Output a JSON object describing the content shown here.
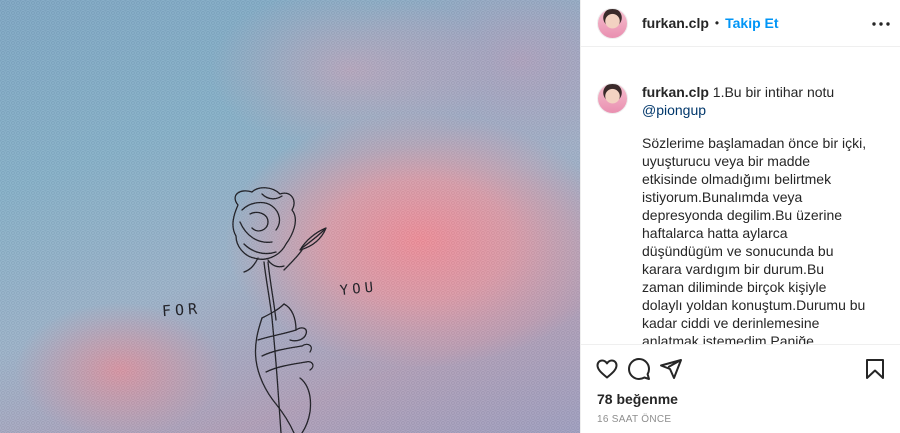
{
  "post": {
    "photo": {
      "label_left": "FOR",
      "label_right": "YOU"
    },
    "header": {
      "username": "furkan.clp",
      "separator": "•",
      "follow_label": "Takip Et",
      "more_icon": "more-horizontal-icon"
    },
    "caption": {
      "username": "furkan.clp",
      "title": "1.Bu bir intihar notu",
      "mention": "@piongup",
      "body": "Sözlerime başlamadan önce bir içki, uyuşturucu veya bir madde etkisinde olmadığımı belirtmek istiyorum.Bunalımda veya depresyonda degilim.Bu üzerine haftalarca hatta aylarca düşündügüm ve sonucunda bu karara vardıgım bir durum.Bu zaman diliminde birçok kişiyle dolaylı yoldan konuştum.Durumu bu kadar ciddi ve derinlemesine anlatmak istemedim.Paniğe kapılmalarını, bu"
    },
    "actions": {
      "like_icon": "heart-icon",
      "comment_icon": "comment-icon",
      "share_icon": "share-icon",
      "save_icon": "bookmark-icon",
      "likes_text": "78 beğenme",
      "timestamp": "16 SAAT ÖNCE"
    }
  }
}
